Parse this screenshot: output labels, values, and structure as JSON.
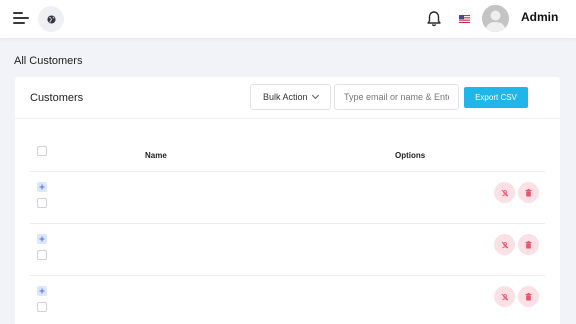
{
  "header": {
    "user_name": "Admin",
    "icons": [
      "menu-icon",
      "globe-icon",
      "bell-icon",
      "us-flag-icon",
      "avatar"
    ],
    "accent_color": "#21b6e9"
  },
  "page": {
    "title": "All Customers"
  },
  "card": {
    "title": "Customers",
    "bulk_action_label": "Bulk Action",
    "search_placeholder": "Type email or name & Enter",
    "export_label": "Export CSV"
  },
  "table": {
    "columns": [
      "Name",
      "Options"
    ],
    "rows": [
      {
        "name": "",
        "actions": [
          "ban-icon",
          "trash-icon"
        ]
      },
      {
        "name": "",
        "actions": [
          "ban-icon",
          "trash-icon"
        ]
      },
      {
        "name": "",
        "actions": [
          "ban-icon",
          "trash-icon"
        ]
      }
    ],
    "action_color": "#e8536b"
  }
}
